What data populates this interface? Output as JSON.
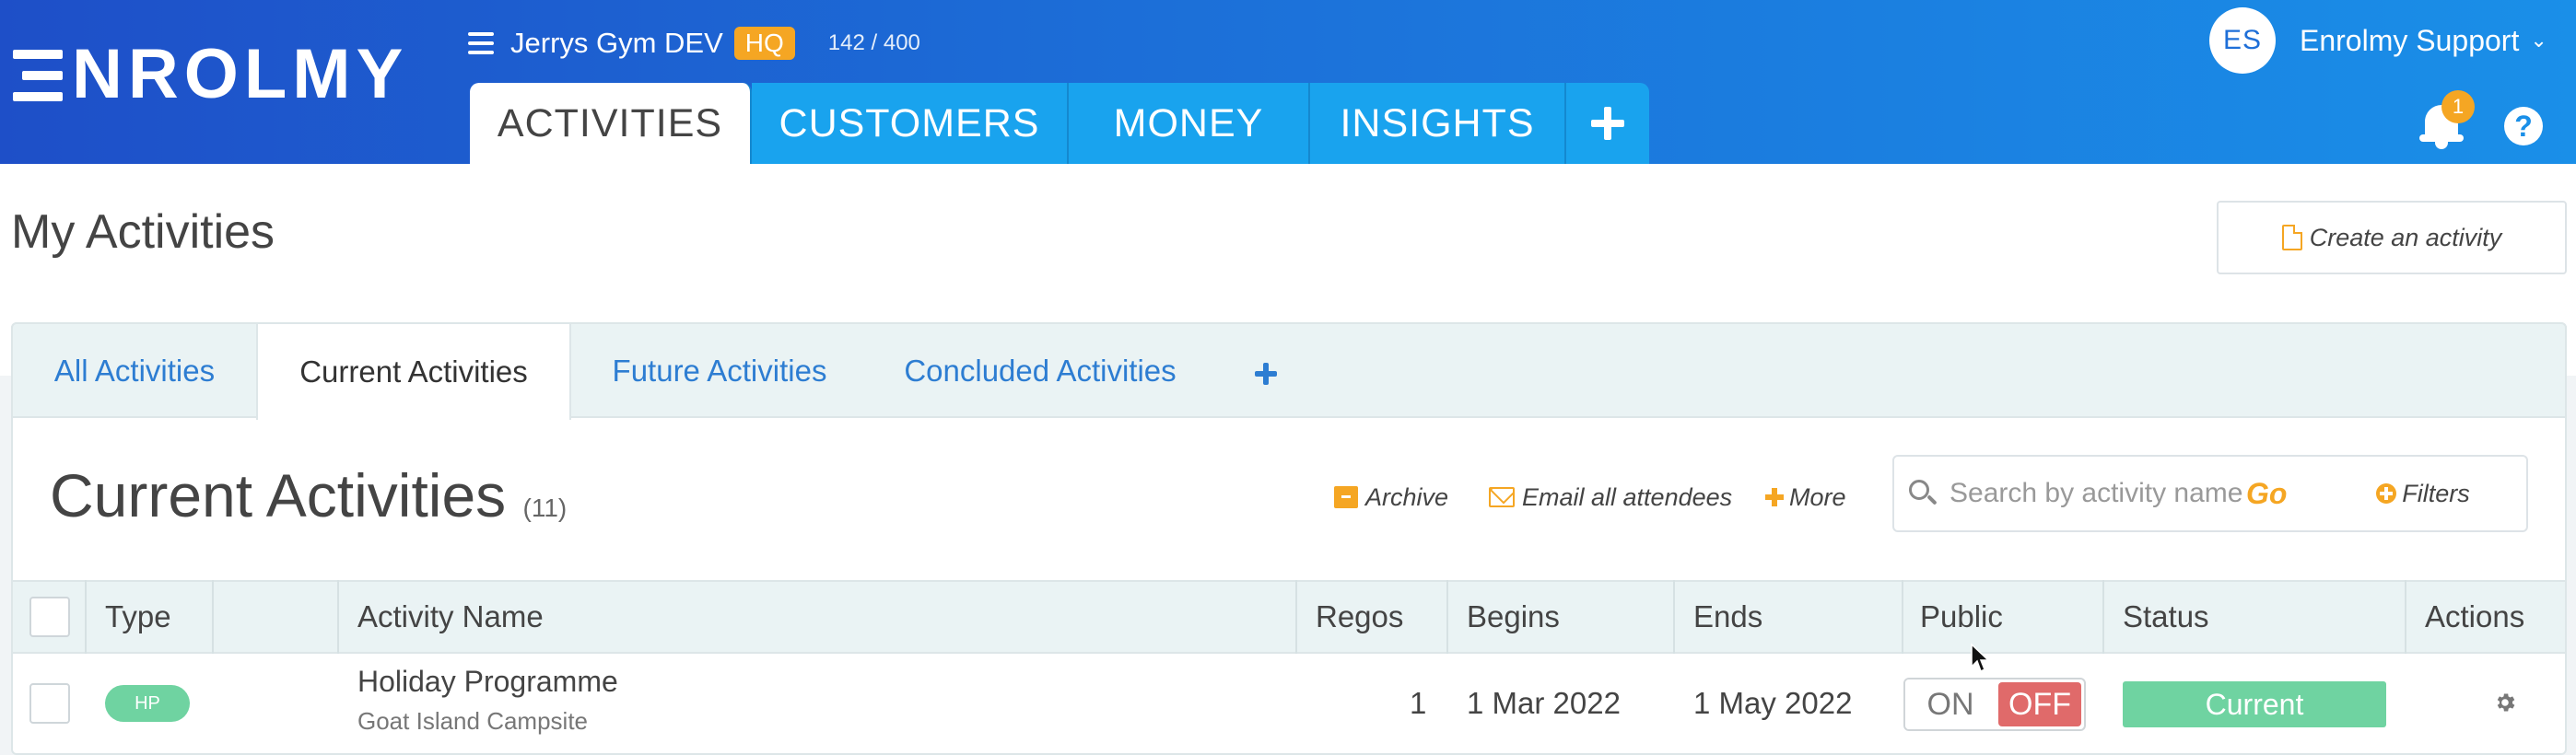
{
  "header": {
    "logo_text": "NROLMY",
    "org_name": "Jerrys Gym DEV",
    "org_badge": "HQ",
    "org_count": "142 / 400",
    "nav_tabs": [
      {
        "label": "ACTIVITIES",
        "active": true
      },
      {
        "label": "CUSTOMERS",
        "active": false
      },
      {
        "label": "MONEY",
        "active": false
      },
      {
        "label": "INSIGHTS",
        "active": false
      }
    ],
    "user_initials": "ES",
    "user_name": "Enrolmy Support",
    "notification_count": "1",
    "help_label": "?"
  },
  "page": {
    "title": "My Activities",
    "create_button": "Create an activity"
  },
  "subtabs": [
    {
      "label": "All Activities",
      "active": false
    },
    {
      "label": "Current Activities",
      "active": true
    },
    {
      "label": "Future Activities",
      "active": false
    },
    {
      "label": "Concluded Activities",
      "active": false
    }
  ],
  "section": {
    "title": "Current Activities",
    "count": "(11)"
  },
  "toolbar": {
    "archive": "Archive",
    "email": "Email all attendees",
    "more": "More",
    "search_placeholder": "Search by activity name",
    "go": "Go",
    "filters": "Filters"
  },
  "table": {
    "columns": [
      "Type",
      "Activity Name",
      "Regos",
      "Begins",
      "Ends",
      "Public",
      "Status",
      "Actions"
    ],
    "rows": [
      {
        "type": "HP",
        "name": "Holiday Programme",
        "location": "Goat Island Campsite",
        "regos": "1",
        "begins": "1 Mar 2022",
        "ends": "1 May 2022",
        "public_on": "ON",
        "public_off": "OFF",
        "status": "Current"
      }
    ]
  },
  "colors": {
    "header_start": "#1e4fc8",
    "header_end": "#1a8fe8",
    "nav_tab": "#19a3ee",
    "accent_orange": "#f5a623",
    "link_blue": "#2d7dd2",
    "status_green": "#6fd3a1",
    "toggle_off_red": "#e06a6a"
  },
  "icons": [
    "menu-icon",
    "chevron-down-icon",
    "plus-icon",
    "bell-icon",
    "help-icon",
    "document-icon",
    "archive-icon",
    "mail-icon",
    "search-icon",
    "gear-icon"
  ]
}
